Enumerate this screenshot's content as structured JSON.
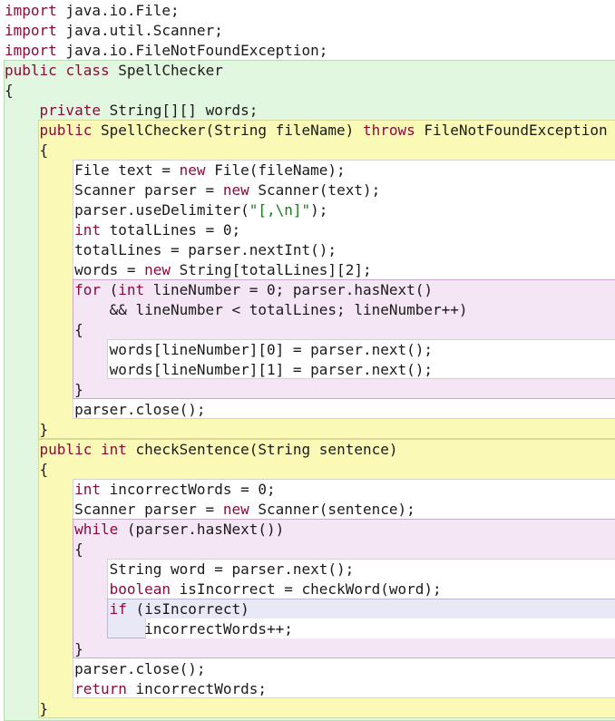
{
  "lines": [
    [
      {
        "t": "import",
        "c": "kw"
      },
      {
        "t": " java.io.File;"
      }
    ],
    [
      {
        "t": "import",
        "c": "kw"
      },
      {
        "t": " java.util.Scanner;"
      }
    ],
    [
      {
        "t": "import",
        "c": "kw"
      },
      {
        "t": " java.io.FileNotFoundException;"
      }
    ],
    [
      {
        "t": "public",
        "c": "kw"
      },
      {
        "t": " "
      },
      {
        "t": "class",
        "c": "kw"
      },
      {
        "t": " SpellChecker"
      }
    ],
    [
      {
        "t": "{"
      }
    ],
    [
      {
        "t": "    "
      },
      {
        "t": "private",
        "c": "kw"
      },
      {
        "t": " String[][] words;"
      }
    ],
    [
      {
        "t": "    "
      },
      {
        "t": "public",
        "c": "kw"
      },
      {
        "t": " SpellChecker(String fileName) "
      },
      {
        "t": "throws",
        "c": "kw"
      },
      {
        "t": " FileNotFoundException"
      }
    ],
    [
      {
        "t": "    {"
      }
    ],
    [
      {
        "t": "        File text = "
      },
      {
        "t": "new",
        "c": "kw"
      },
      {
        "t": " File(fileName);"
      }
    ],
    [
      {
        "t": "        Scanner parser = "
      },
      {
        "t": "new",
        "c": "kw"
      },
      {
        "t": " Scanner(text);"
      }
    ],
    [
      {
        "t": "        parser.useDelimiter("
      },
      {
        "t": "\"[,\\n]\"",
        "c": "str"
      },
      {
        "t": ");"
      }
    ],
    [
      {
        "t": "        "
      },
      {
        "t": "int",
        "c": "kw"
      },
      {
        "t": " totalLines = 0;"
      }
    ],
    [
      {
        "t": "        totalLines = parser.nextInt();"
      }
    ],
    [
      {
        "t": "        words = "
      },
      {
        "t": "new",
        "c": "kw"
      },
      {
        "t": " String[totalLines][2];"
      }
    ],
    [
      {
        "t": "        "
      },
      {
        "t": "for",
        "c": "kw"
      },
      {
        "t": " ("
      },
      {
        "t": "int",
        "c": "kw"
      },
      {
        "t": " lineNumber = 0; parser.hasNext()"
      }
    ],
    [
      {
        "t": "            && lineNumber < totalLines; lineNumber++)"
      }
    ],
    [
      {
        "t": "        {"
      }
    ],
    [
      {
        "t": "            words[lineNumber][0] = parser.next();"
      }
    ],
    [
      {
        "t": "            words[lineNumber][1] = parser.next();"
      }
    ],
    [
      {
        "t": "        }"
      }
    ],
    [
      {
        "t": "        parser.close();"
      }
    ],
    [
      {
        "t": "    }"
      }
    ],
    [
      {
        "t": "    "
      },
      {
        "t": "public",
        "c": "kw"
      },
      {
        "t": " "
      },
      {
        "t": "int",
        "c": "kw"
      },
      {
        "t": " checkSentence(String sentence)"
      }
    ],
    [
      {
        "t": "    {"
      }
    ],
    [
      {
        "t": "        "
      },
      {
        "t": "int",
        "c": "kw"
      },
      {
        "t": " incorrectWords = 0;"
      }
    ],
    [
      {
        "t": "        Scanner parser = "
      },
      {
        "t": "new",
        "c": "kw"
      },
      {
        "t": " Scanner(sentence);"
      }
    ],
    [
      {
        "t": "        "
      },
      {
        "t": "while",
        "c": "kw"
      },
      {
        "t": " (parser.hasNext())"
      }
    ],
    [
      {
        "t": "        {"
      }
    ],
    [
      {
        "t": "            String word = parser.next();"
      }
    ],
    [
      {
        "t": "            "
      },
      {
        "t": "boolean",
        "c": "kw"
      },
      {
        "t": " isIncorrect = checkWord(word);"
      }
    ],
    [
      {
        "t": "            "
      },
      {
        "t": "if",
        "c": "kw"
      },
      {
        "t": " (isIncorrect)"
      }
    ],
    [
      {
        "t": "                incorrectWords++;"
      }
    ],
    [
      {
        "t": "        }"
      }
    ],
    [
      {
        "t": "        parser.close();"
      }
    ],
    [
      {
        "t": "        "
      },
      {
        "t": "return",
        "c": "kw"
      },
      {
        "t": " incorrectWords;"
      }
    ],
    [
      {
        "t": "    }"
      }
    ]
  ]
}
